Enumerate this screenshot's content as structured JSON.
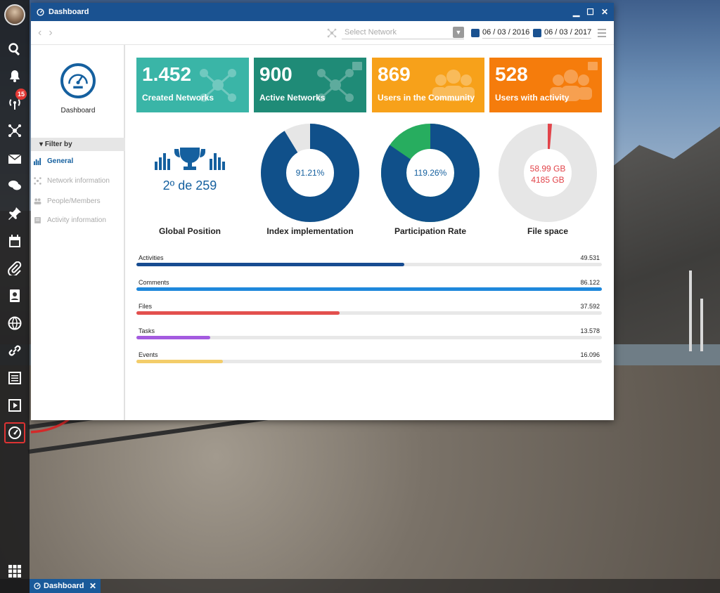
{
  "window": {
    "title": "Dashboard"
  },
  "taskbar": {
    "tab_label": "Dashboard"
  },
  "dock": {
    "notification_count": "15"
  },
  "toolbar": {
    "network_placeholder": "Select Network",
    "date_from": "06 / 03 / 2016",
    "date_to": "06 / 03 / 2017"
  },
  "sidebar": {
    "dashboard_label": "Dashboard",
    "filter_heading": "Filter by",
    "items": [
      {
        "label": "General",
        "icon": "bar-chart-icon"
      },
      {
        "label": "Network information",
        "icon": "network-icon"
      },
      {
        "label": "People/Members",
        "icon": "people-icon"
      },
      {
        "label": "Activity information",
        "icon": "notes-icon"
      }
    ]
  },
  "cards": [
    {
      "value": "1.452",
      "label": "Created Networks",
      "color": "#3ab5a7",
      "icon": "network-icon"
    },
    {
      "value": "900",
      "label": "Active Networks",
      "color": "#1f8b77",
      "icon": "network-icon"
    },
    {
      "value": "869",
      "label": "Users in the Community",
      "color": "#f7a11a",
      "icon": "group-icon"
    },
    {
      "value": "528",
      "label": "Users with activity",
      "color": "#f57c0c",
      "icon": "group-icon"
    }
  ],
  "stats": {
    "global_position": {
      "value": "2º de 259",
      "caption": "Global Position"
    },
    "index_implementation": {
      "text": "91.21%",
      "caption": "Index implementation",
      "percent": 91.21,
      "color": "#10508a",
      "rest_color": "#e6e6e6"
    },
    "participation_rate": {
      "text": "119.26%",
      "caption": "Participation Rate",
      "percent": 84.5,
      "color": "#10508a",
      "rest_color": "#27ad5f"
    },
    "file_space": {
      "line1": "58.99 GB",
      "line2": "4185 GB",
      "caption": "File space",
      "percent": 1.4,
      "color": "#e2444a",
      "rest_color": "#e6e6e6"
    }
  },
  "activity_bars": [
    {
      "label": "Activities",
      "value": "49.531",
      "fraction": 0.575,
      "color": "#174c91"
    },
    {
      "label": "Comments",
      "value": "86.122",
      "fraction": 1.0,
      "color": "#1e88dc"
    },
    {
      "label": "Files",
      "value": "37.592",
      "fraction": 0.436,
      "color": "#e3504e"
    },
    {
      "label": "Tasks",
      "value": "13.578",
      "fraction": 0.158,
      "color": "#a45be0"
    },
    {
      "label": "Events",
      "value": "16.096",
      "fraction": 0.186,
      "color": "#f3cd6a"
    }
  ]
}
